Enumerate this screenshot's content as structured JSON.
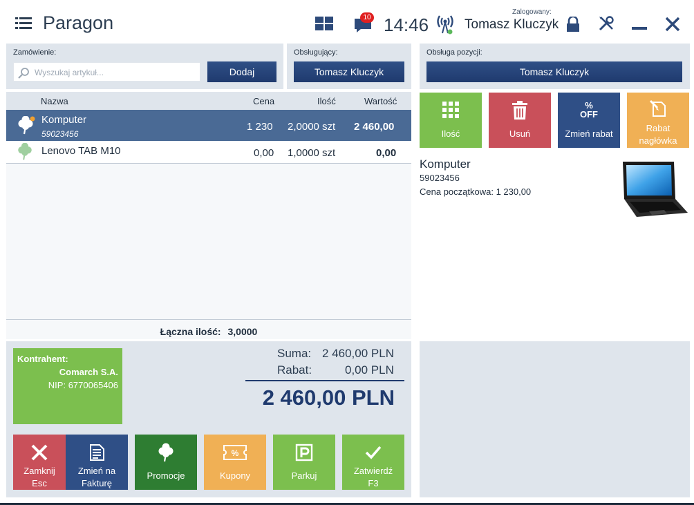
{
  "header": {
    "title": "Paragon",
    "notifications": "10",
    "clock": "14:46",
    "logged_label": "Zalogowany:",
    "logged_user": "Tomasz Kluczyk"
  },
  "order": {
    "label": "Zamówienie:",
    "search_placeholder": "Wyszukaj artykuł...",
    "add_button": "Dodaj"
  },
  "served_by": {
    "label": "Obsługujący:",
    "value": "Tomasz Kluczyk"
  },
  "position_service": {
    "label": "Obsługa pozycji:",
    "value": "Tomasz Kluczyk"
  },
  "table": {
    "headers": {
      "name": "Nazwa",
      "price": "Cena",
      "qty": "Ilość",
      "value": "Wartość"
    },
    "rows": [
      {
        "name": "Komputer",
        "code": "59023456",
        "price": "1 230",
        "qty": "2,0000 szt",
        "value": "2 460,00"
      },
      {
        "name": "Lenovo TAB M10",
        "code": "",
        "price": "0,00",
        "qty": "1,0000 szt",
        "value": "0,00"
      }
    ],
    "total_qty_label": "Łączna ilość:",
    "total_qty_value": "3,0000"
  },
  "contractor": {
    "label": "Kontrahent:",
    "name": "Comarch S.A.",
    "nip": "NIP: 6770065406"
  },
  "summary": {
    "sum_label": "Suma:",
    "sum_value": "2 460,00 PLN",
    "discount_label": "Rabat:",
    "discount_value": "0,00 PLN",
    "grand_total": "2 460,00 PLN"
  },
  "actions": {
    "close_line1": "Zamknij",
    "close_line2": "Esc",
    "invoice_line1": "Zmień na",
    "invoice_line2": "Fakturę",
    "promotions": "Promocje",
    "coupons": "Kupony",
    "park": "Parkuj",
    "confirm_line1": "Zatwierdź",
    "confirm_line2": "F3"
  },
  "tiles": {
    "quantity": "Ilość",
    "delete": "Usuń",
    "discount_icon": "% OFF",
    "change_discount": "Zmień rabat",
    "header_discount_line1": "Rabat",
    "header_discount_line2": "nagłówka"
  },
  "detail": {
    "name": "Komputer",
    "code": "59023456",
    "initial_price": "Cena początkowa: 1 230,00"
  },
  "colors": {
    "accent_blue": "#1f3a6e",
    "selected_row": "#4a6a95",
    "green": "#7cbf4e",
    "dark_green": "#2e7d32",
    "red": "#c9505a",
    "orange": "#f0b055",
    "panel": "#dfe5ec"
  }
}
